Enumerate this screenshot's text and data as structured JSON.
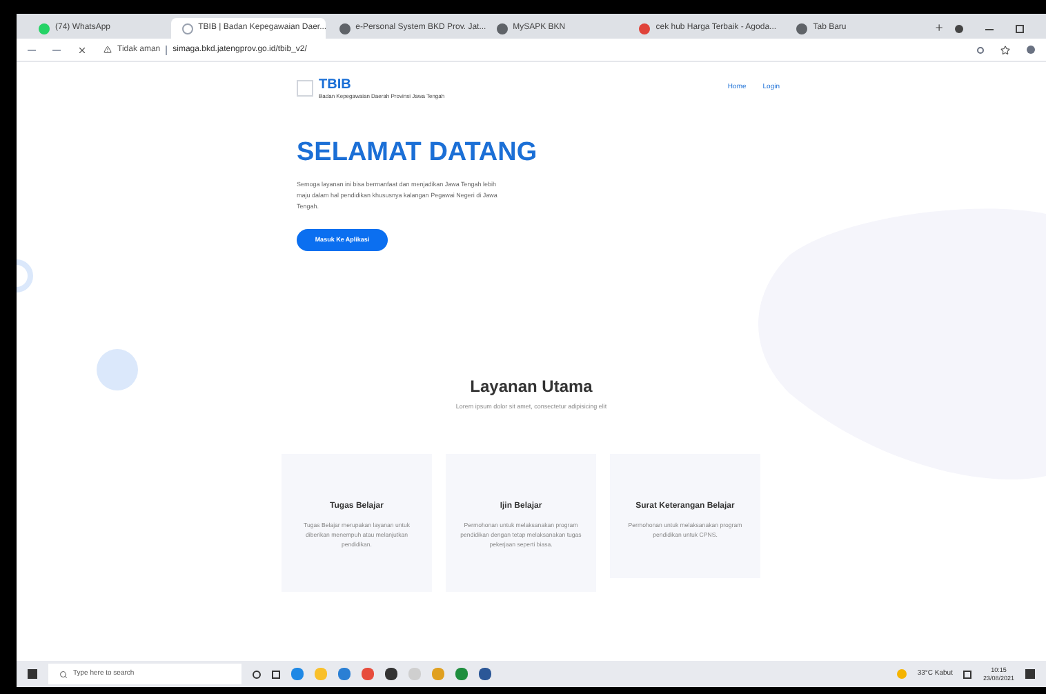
{
  "browser": {
    "tabs": [
      {
        "title": "(74) WhatsApp",
        "selected": false
      },
      {
        "title": "TBIB | Badan Kepegawaian Daer...",
        "selected": true
      },
      {
        "title": "e-Personal System BKD Prov. Jat...",
        "selected": false
      },
      {
        "title": "MySAPK BKN",
        "selected": false
      },
      {
        "title": "cek hub Harga Terbaik - Agoda...",
        "selected": false
      },
      {
        "title": "Tab Baru",
        "selected": false
      }
    ],
    "security": "Tidak aman",
    "url": "simaga.bkd.jatengprov.go.id/tbib_v2/"
  },
  "site": {
    "brand": "TBIB",
    "brand_subtitle": "Badan Kepegawaian Daerah Provinsi Jawa Tengah",
    "nav": [
      "Home",
      "Login"
    ],
    "hero": {
      "title": "SELAMAT DATANG",
      "text": "Semoga layanan ini bisa bermanfaat dan menjadikan Jawa Tengah lebih maju dalam hal pendidikan khususnya kalangan Pegawai Negeri di Jawa Tengah.",
      "button": "Masuk Ke Aplikasi"
    },
    "services": {
      "title": "Layanan Utama",
      "subtitle": "Lorem ipsum dolor sit amet, consectetur adipisicing elit",
      "cards": [
        {
          "title": "Tugas Belajar",
          "text": "Tugas Belajar merupakan layanan untuk diberikan menempuh atau melanjutkan pendidikan."
        },
        {
          "title": "Ijin Belajar",
          "text": "Permohonan untuk melaksanakan program pendidikan dengan tetap melaksanakan tugas pekerjaan seperti biasa."
        },
        {
          "title": "Surat Keterangan Belajar",
          "text": "Permohonan untuk melaksanakan program pendidikan untuk CPNS."
        }
      ]
    }
  },
  "taskbar": {
    "search_placeholder": "Type here to search",
    "weather": "33°C Kabut",
    "time": "10:15",
    "date": "23/08/2021"
  }
}
